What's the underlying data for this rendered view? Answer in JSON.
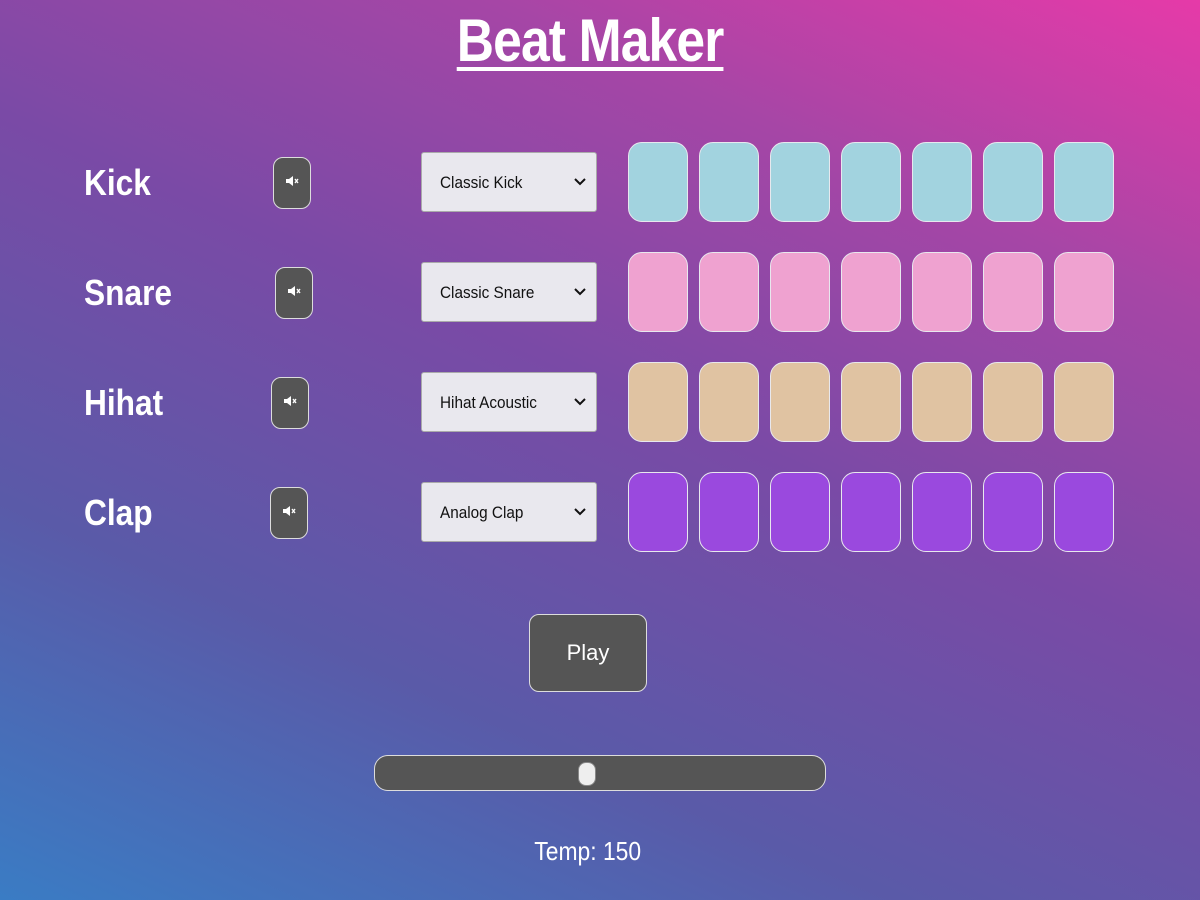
{
  "title": "Beat Maker",
  "tracks": [
    {
      "name": "Kick",
      "selected": "Classic Kick",
      "pad_color": "#a2d3df",
      "muted": true,
      "mute_icon": "speaker-mute-icon"
    },
    {
      "name": "Snare",
      "selected": "Classic Snare",
      "pad_color": "#efa2d0",
      "muted": true,
      "mute_icon": "speaker-mute-icon"
    },
    {
      "name": "Hihat",
      "selected": "Hihat Acoustic",
      "pad_color": "#e0c3a2",
      "muted": true,
      "mute_icon": "speaker-mute-icon"
    },
    {
      "name": "Clap",
      "selected": "Analog Clap",
      "pad_color": "#9a49de",
      "muted": true,
      "mute_icon": "speaker-mute-icon"
    }
  ],
  "pads_per_track": 7,
  "play_label": "Play",
  "tempo": {
    "label": "Temp: 150",
    "value": 150,
    "fraction": 0.47
  },
  "colors": {
    "control_bg": "#555555",
    "select_bg": "#e9e8ee"
  }
}
